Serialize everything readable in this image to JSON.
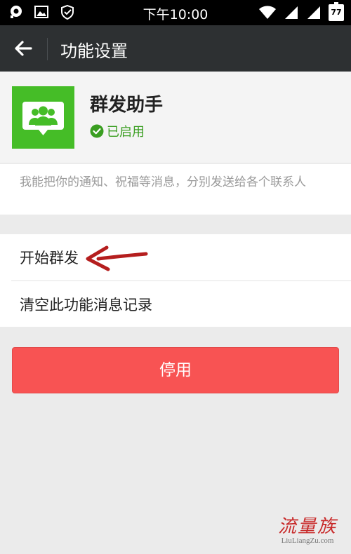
{
  "status_bar": {
    "time": "下午10:00",
    "battery": "77"
  },
  "header": {
    "title": "功能设置"
  },
  "app": {
    "name": "群发助手",
    "status": "已启用",
    "icon": "group-chat-icon",
    "accent": "#45bd27"
  },
  "description": "我能把你的通知、祝福等消息，分别发送给各个联系人",
  "menu": {
    "items": [
      {
        "label": "开始群发"
      },
      {
        "label": "清空此功能消息记录"
      }
    ]
  },
  "stop_button": {
    "label": "停用",
    "color": "#f85353"
  },
  "watermark": {
    "main": "流量族",
    "sub": "LiuLiangZu.com"
  }
}
